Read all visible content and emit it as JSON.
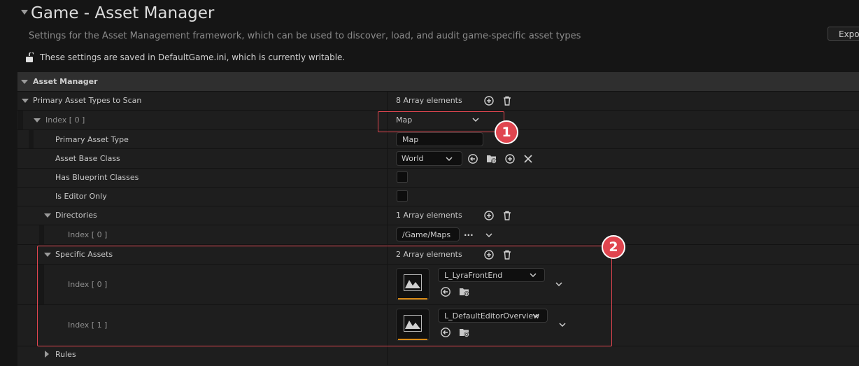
{
  "header": {
    "title": "Game - Asset Manager",
    "subtitle": "Settings for the Asset Management framework, which can be used to discover, load, and audit game-specific asset types",
    "export_label": "Expor",
    "writable_notice": "These settings are saved in DefaultGame.ini, which is currently writable."
  },
  "section": {
    "title": "Asset Manager"
  },
  "primary_asset_types": {
    "label": "Primary Asset Types to Scan",
    "count": "8 Array elements",
    "index0": {
      "label": "Index [ 0 ]",
      "value": "Map",
      "primary_asset_type_label": "Primary Asset Type",
      "primary_asset_type_value": "Map",
      "asset_base_class_label": "Asset Base Class",
      "asset_base_class_value": "World",
      "has_blueprint_classes_label": "Has Blueprint Classes",
      "has_blueprint_classes_checked": false,
      "is_editor_only_label": "Is Editor Only",
      "is_editor_only_checked": false,
      "directories": {
        "label": "Directories",
        "count": "1 Array elements",
        "item0_label": "Index [ 0 ]",
        "item0_value": "/Game/Maps",
        "more": "..."
      },
      "specific_assets": {
        "label": "Specific Assets",
        "count": "2 Array elements",
        "items": [
          {
            "label": "Index [ 0 ]",
            "value": "L_LyraFrontEnd"
          },
          {
            "label": "Index [ 1 ]",
            "value": "L_DefaultEditorOverview"
          }
        ]
      },
      "rules_label": "Rules"
    }
  },
  "callouts": [
    "1",
    "2"
  ],
  "colors": {
    "callout": "#e0454f",
    "thumbnail_underline": "#d98a16",
    "background": "#151515"
  }
}
